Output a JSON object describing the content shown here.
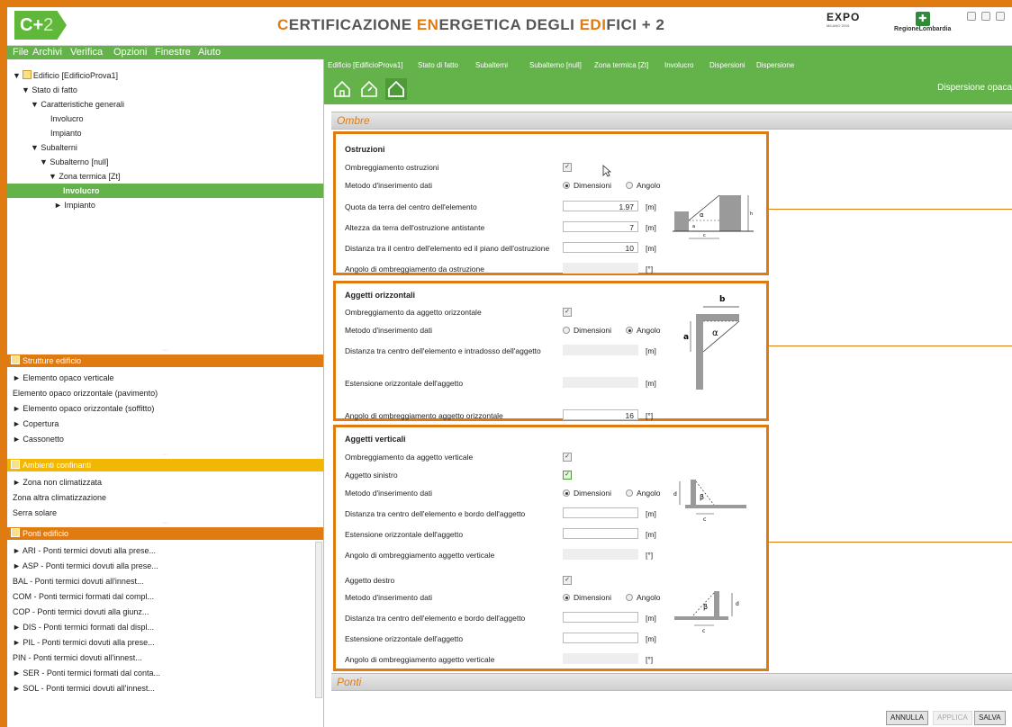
{
  "app": {
    "logo": "C+",
    "logo_sup": "2",
    "title_parts": [
      "C",
      "ERTIFICAZIONE ",
      "EN",
      "ERGETICA DEGLI ",
      "EDI",
      "FICI + 2"
    ],
    "expo": "EXPO",
    "expo_sub": "MILANO 2015",
    "region": "RegioneLombardia"
  },
  "menu": [
    "File",
    "Archivi",
    "Verifica",
    "Opzioni",
    "Finestre",
    "Aiuto"
  ],
  "tree": [
    {
      "label": "Edificio [EdificioProva1]",
      "indent": 0
    },
    {
      "label": "▼ Stato di fatto",
      "indent": 1
    },
    {
      "label": "▼ Caratteristiche generali",
      "indent": 2
    },
    {
      "label": "Involucro",
      "indent": 3
    },
    {
      "label": "Impianto",
      "indent": 3
    },
    {
      "label": "▼ Subalterni",
      "indent": 2
    },
    {
      "label": "▼ Subalterno [null]",
      "indent": 3
    },
    {
      "label": "▼ Zona termica [Zt]",
      "indent": 4
    },
    {
      "label": "Involucro",
      "indent": 5,
      "selected": true
    },
    {
      "label": "► Impianto",
      "indent": 5
    }
  ],
  "strutture": {
    "title": "Strutture edificio",
    "items": [
      "► Elemento opaco verticale",
      "Elemento opaco orizzontale (pavimento)",
      "► Elemento opaco orizzontale (soffitto)",
      "► Copertura",
      "► Cassonetto"
    ]
  },
  "ambienti": {
    "title": "Ambienti confinanti",
    "items": [
      "► Zona non climatizzata",
      "Zona altra climatizzazione",
      "Serra solare"
    ]
  },
  "ponti": {
    "title": "Ponti edificio",
    "items": [
      "► ARI - Ponti termici dovuti alla prese...",
      "► ASP - Ponti termici dovuti alla prese...",
      "BAL - Ponti termici dovuti all'innest...",
      "COM - Ponti termici formati dal compl...",
      "COP - Ponti termici dovuti alla giunz...",
      "► DIS - Ponti termici formati dal displ...",
      "► PIL - Ponti termici dovuti alla prese...",
      "PIN - Ponti termici dovuti all'innest...",
      "► SER - Ponti termici formati dal conta...",
      "► SOL - Ponti termici dovuti all'innest..."
    ]
  },
  "breadcrumb": [
    "Edificio [EdificioProva1]",
    "Stato di fatto",
    "Subalterni",
    "Subalterno [null]",
    "Zona termica [Zt]",
    "Involucro",
    "Dispersioni",
    "Dispersione"
  ],
  "toolbar_title": "Dispersione opaca",
  "sections": {
    "ombre": "Ombre",
    "ponti": "Ponti"
  },
  "ostruzioni": {
    "title": "Ostruzioni",
    "ombreggiamento": "Ombreggiamento ostruzioni",
    "metodo": "Metodo d'inserimento dati",
    "opt_dim": "Dimensioni",
    "opt_ang": "Angolo",
    "quota": "Quota da terra del centro dell'elemento",
    "quota_val": "1.97",
    "altezza": "Altezza da terra dell'ostruzione antistante",
    "altezza_val": "7",
    "distanza": "Distanza tra il centro dell'elemento ed il piano dell'ostruzione",
    "distanza_val": "10",
    "angolo": "Angolo di ombreggiamento da ostruzione",
    "unit_m": "[m]",
    "unit_deg": "[°]"
  },
  "orizzontali": {
    "title": "Aggetti orizzontali",
    "ombreggiamento": "Ombreggiamento da aggetto orizzontale",
    "metodo": "Metodo d'inserimento dati",
    "distanza": "Distanza tra centro dell'elemento e intradosso dell'aggetto",
    "estensione": "Estensione orizzontale dell'aggetto",
    "angolo": "Angolo di ombreggiamento aggetto orizzontale",
    "angolo_val": "16"
  },
  "verticali": {
    "title": "Aggetti verticali",
    "ombreggiamento": "Ombreggiamento da aggetto verticale",
    "sinistro": "Aggetto sinistro",
    "destro": "Aggetto destro",
    "metodo": "Metodo d'inserimento dati",
    "distanza": "Distanza tra centro dell'elemento e bordo dell'aggetto",
    "estensione": "Estensione orizzontale dell'aggetto",
    "angolo": "Angolo di ombreggiamento aggetto verticale"
  },
  "diagram_labels": {
    "alpha": "α",
    "beta": "β",
    "a": "a",
    "b": "b",
    "c": "c",
    "d": "d",
    "h": "h"
  },
  "buttons": {
    "annulla": "ANNULLA",
    "applica": "APPLICA",
    "salva": "SALVA"
  },
  "colors": {
    "accent": "#e07b12",
    "green": "#63b34a"
  }
}
